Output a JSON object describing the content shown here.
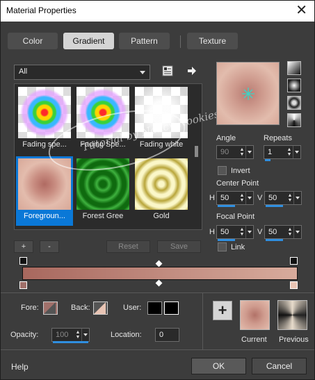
{
  "window": {
    "title": "Material Properties",
    "close_glyph": "✕"
  },
  "tabs": [
    {
      "label": "Color"
    },
    {
      "label": "Gradient",
      "active": true
    },
    {
      "label": "Pattern"
    },
    {
      "label": "Texture"
    }
  ],
  "category": {
    "selected": "All"
  },
  "gallery": {
    "tiles": [
      {
        "label": "Fading spe...",
        "icon": "rainbow-checker-swatch"
      },
      {
        "label": "Fading Spe...",
        "icon": "rainbow-checker-swatch"
      },
      {
        "label": "Fading white",
        "icon": "white-checker-swatch"
      },
      {
        "label": "Foregroun...",
        "icon": "pink-radial-swatch",
        "selected": true
      },
      {
        "label": "Forest Gree",
        "icon": "green-radial-swatch"
      },
      {
        "label": "Gold",
        "icon": "gold-radial-swatch"
      }
    ],
    "watermark": "Tutorial by Nancy Nookies"
  },
  "list_buttons": {
    "add": "+",
    "remove": "-",
    "reset": "Reset",
    "save": "Save"
  },
  "gradient": {
    "angle_label": "Angle",
    "angle_value": "90",
    "repeats_label": "Repeats",
    "repeats_value": "1",
    "invert_label": "Invert",
    "center_label": "Center Point",
    "center_h_label": "H",
    "center_h": "50",
    "center_v_label": "V",
    "center_v": "50",
    "focal_label": "Focal Point",
    "focal_h_label": "H",
    "focal_h": "50",
    "focal_v_label": "V",
    "focal_v": "50",
    "link_label": "Link"
  },
  "colors": {
    "foreground": "#a0706a",
    "background": "#e8c4b4",
    "accent": "#0a78d7"
  },
  "bottom": {
    "fore_label": "Fore:",
    "back_label": "Back:",
    "user_label": "User:",
    "opacity_label": "Opacity:",
    "opacity_value": "100",
    "location_label": "Location:",
    "location_value": "0",
    "add_glyph": "+",
    "current_label": "Current",
    "previous_label": "Previous"
  },
  "footer": {
    "help": "Help",
    "ok": "OK",
    "cancel": "Cancel"
  }
}
